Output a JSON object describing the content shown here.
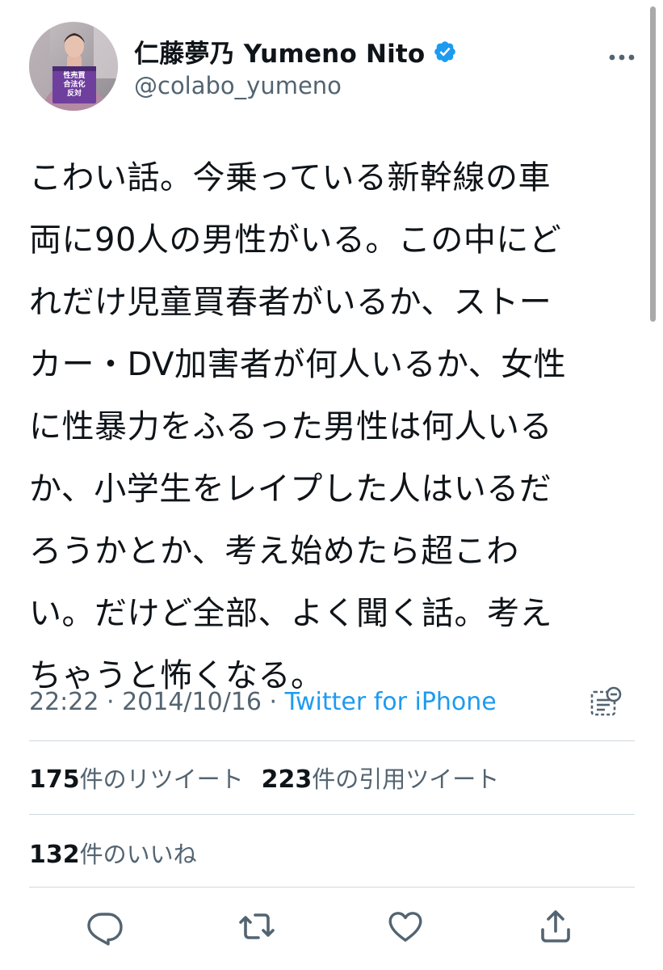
{
  "author": {
    "display_name": "仁藤夢乃  Yumeno Nito",
    "handle": "@colabo_yumeno",
    "verified": true,
    "avatar_sign_lines": [
      "性売買",
      "合法化",
      "反対"
    ]
  },
  "tweet": {
    "lines": [
      "こわい話。今乗っている新幹線の車",
      "両に90人の男性がいる。この中にど",
      "れだけ児童買春者がいるか、ストー",
      "カー・DV加害者が何人いるか、女性",
      "に性暴力をふるった男性は何人いる",
      "か、小学生をレイプした人はいるだ",
      "ろうかとか、考え始めたら超こわ",
      "い。だけど全部、よく聞く話。考え",
      "ちゃうと怖くなる。"
    ]
  },
  "meta": {
    "time": "22:22",
    "separator": " · ",
    "date": "2014/10/16",
    "source": "Twitter for iPhone"
  },
  "stats": {
    "retweets_count": "175",
    "retweets_label": "件のリツイート",
    "quotes_count": "223",
    "quotes_label": "件の引用ツイート",
    "likes_count": "132",
    "likes_label": "件のいいね"
  },
  "icons": {
    "more": "more-icon",
    "verified": "verified-badge-icon",
    "translate": "translate-icon",
    "reply": "reply-icon",
    "retweet": "retweet-icon",
    "like": "like-icon",
    "share": "share-icon"
  },
  "colors": {
    "text": "#0f1419",
    "secondary": "#536471",
    "accent": "#1d9bf0",
    "divider": "#cfd9de"
  }
}
